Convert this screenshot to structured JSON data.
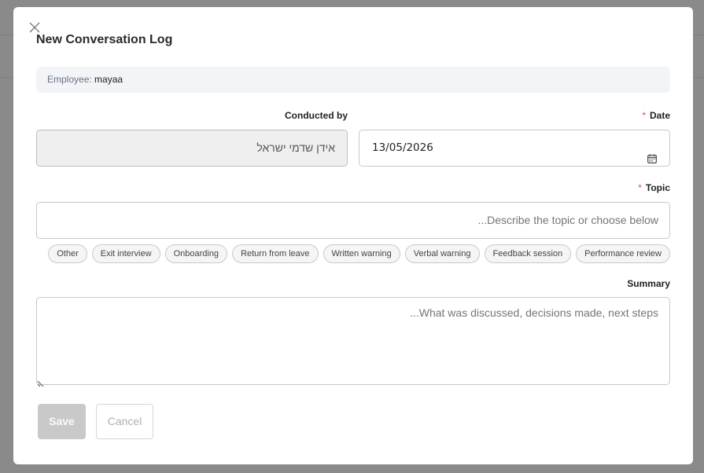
{
  "dialog": {
    "title": "New Conversation Log"
  },
  "employee": {
    "label": "Employee:",
    "value": "mayaa"
  },
  "conducted_by": {
    "label": "Conducted by",
    "value": "אידן שדמי ישראל"
  },
  "date": {
    "required_mark": "*",
    "label": "Date",
    "value": "13/05/2026"
  },
  "topic": {
    "required_mark": "*",
    "label": "Topic",
    "placeholder": "...Describe the topic or choose below",
    "chips": [
      "Performance review",
      "Feedback session",
      "Verbal warning",
      "Written warning",
      "Return from leave",
      "Onboarding",
      "Exit interview",
      "Other"
    ]
  },
  "summary": {
    "label": "Summary",
    "placeholder": "...What was discussed, decisions made, next steps"
  },
  "actions": {
    "save_label": "Save",
    "cancel_label": "Cancel"
  },
  "icons": {
    "close": "close-icon",
    "calendar": "calendar-icon"
  }
}
